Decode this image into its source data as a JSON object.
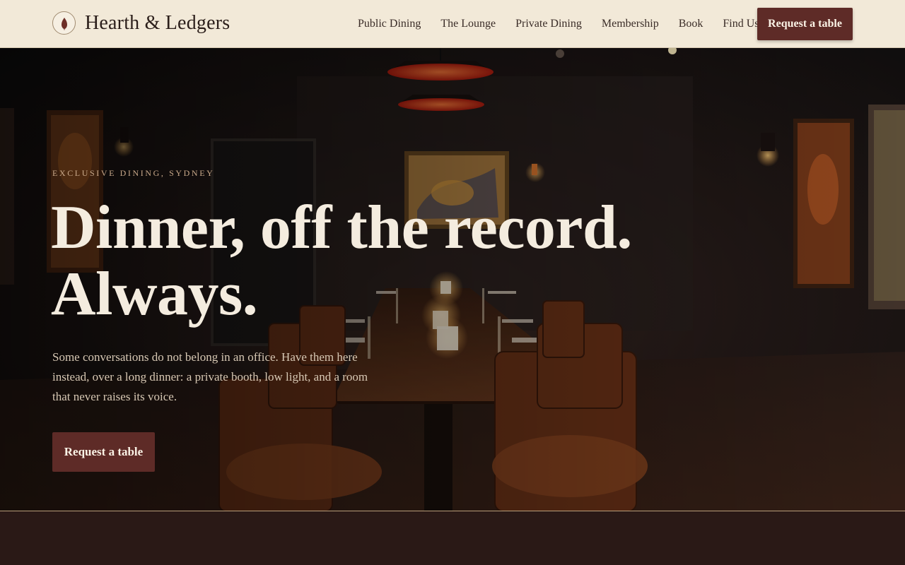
{
  "header": {
    "brand_name": "Hearth & Ledgers",
    "nav": [
      {
        "label": "Public Dining"
      },
      {
        "label": "The Lounge"
      },
      {
        "label": "Private Dining"
      },
      {
        "label": "Membership"
      },
      {
        "label": "Book"
      },
      {
        "label": "Find Us"
      }
    ],
    "cta_label": "Request a table"
  },
  "hero": {
    "eyebrow": "EXCLUSIVE DINING, SYDNEY",
    "headline_line1": "Dinner, off the record.",
    "headline_line2": "Always.",
    "lede": "Some conversations do not belong in an office. Have them here instead, over a long dinner: a private booth, low light, and a room that never raises its voice.",
    "cta_label": "Request a table",
    "image_subject": "dimly-lit private dining room with long wooden table, leather chairs, candles and red pendant lamps"
  },
  "colors": {
    "header_bg": "#f2e9d8",
    "brand_text": "#2b1e1a",
    "accent": "#5e2b27",
    "hero_headline": "#f4ecdf",
    "eyebrow": "#c9a98a",
    "page_bg": "#2a1916"
  },
  "icons": {
    "logo": "flame-emblem-icon"
  }
}
